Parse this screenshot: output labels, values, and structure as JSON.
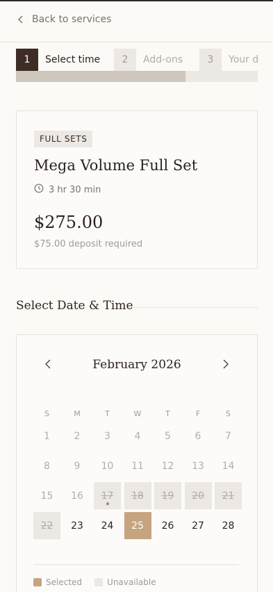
{
  "header": {
    "back_label": "Back to services"
  },
  "steps": [
    {
      "num": "1",
      "label": "Select time",
      "state": "active"
    },
    {
      "num": "2",
      "label": "Add-ons",
      "state": "inactive"
    },
    {
      "num": "3",
      "label": "Your d",
      "state": "inactive"
    }
  ],
  "progress": {
    "fraction": 0.7
  },
  "service": {
    "category": "FULL SETS",
    "title": "Mega Volume Full Set",
    "duration": "3 hr 30 min",
    "price": "$275.00",
    "deposit": "$75.00 deposit required"
  },
  "section": {
    "title": "Select Date & Time"
  },
  "calendar": {
    "month_label": "February 2026",
    "weekdays": [
      "S",
      "M",
      "T",
      "W",
      "T",
      "F",
      "S"
    ],
    "days": [
      {
        "d": "1",
        "s": "past"
      },
      {
        "d": "2",
        "s": "past"
      },
      {
        "d": "3",
        "s": "past"
      },
      {
        "d": "4",
        "s": "past"
      },
      {
        "d": "5",
        "s": "past"
      },
      {
        "d": "6",
        "s": "past"
      },
      {
        "d": "7",
        "s": "past"
      },
      {
        "d": "8",
        "s": "past"
      },
      {
        "d": "9",
        "s": "past"
      },
      {
        "d": "10",
        "s": "past"
      },
      {
        "d": "11",
        "s": "past"
      },
      {
        "d": "12",
        "s": "past"
      },
      {
        "d": "13",
        "s": "past"
      },
      {
        "d": "14",
        "s": "past"
      },
      {
        "d": "15",
        "s": "past"
      },
      {
        "d": "16",
        "s": "past"
      },
      {
        "d": "17",
        "s": "unavail",
        "today": true
      },
      {
        "d": "18",
        "s": "unavail"
      },
      {
        "d": "19",
        "s": "unavail"
      },
      {
        "d": "20",
        "s": "unavail"
      },
      {
        "d": "21",
        "s": "unavail"
      },
      {
        "d": "22",
        "s": "unavail"
      },
      {
        "d": "23",
        "s": "avail"
      },
      {
        "d": "24",
        "s": "avail"
      },
      {
        "d": "25",
        "s": "selected"
      },
      {
        "d": "26",
        "s": "avail"
      },
      {
        "d": "27",
        "s": "avail"
      },
      {
        "d": "28",
        "s": "avail"
      }
    ],
    "legend": [
      {
        "label": "Selected",
        "color": "#c6a47f"
      },
      {
        "label": "Unavailable",
        "color": "#ece8e3"
      }
    ]
  },
  "colors": {
    "accent": "#c6a47f",
    "dark": "#3e2c25",
    "muted": "#ece8e3"
  }
}
